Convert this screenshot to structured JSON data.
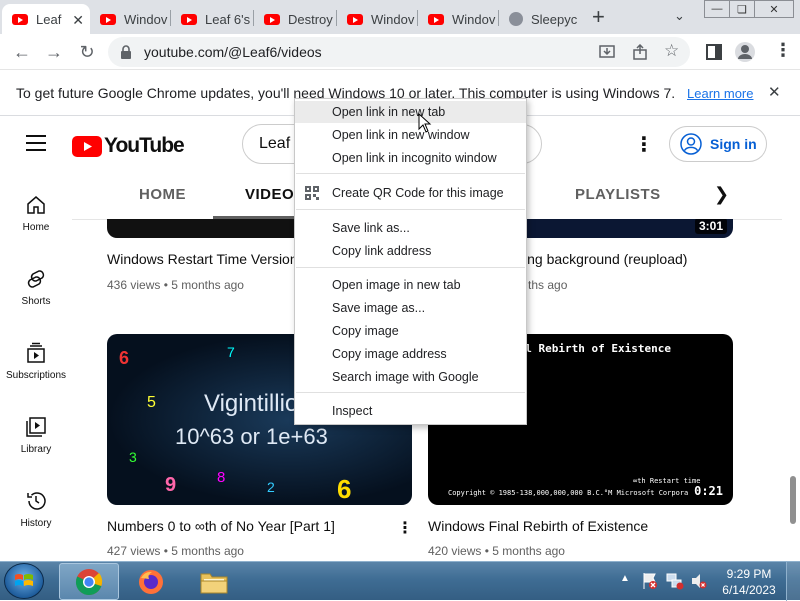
{
  "browser": {
    "tabs": [
      {
        "title": "Leaf",
        "active": true
      },
      {
        "title": "Windov"
      },
      {
        "title": "Leaf 6's"
      },
      {
        "title": "Destroy"
      },
      {
        "title": "Windov"
      },
      {
        "title": "Windov"
      },
      {
        "title": "Sleepyc"
      }
    ],
    "new_tab": "+",
    "url": "youtube.com/@Leaf6/videos"
  },
  "infobar": {
    "message": "To get future Google Chrome updates, you'll need Windows 10 or later. This computer is using Windows 7.",
    "learn_more": "Learn more",
    "close": "✕"
  },
  "youtube": {
    "logo_text": "YouTube",
    "search_value": "Leaf",
    "sign_in": "Sign in",
    "sidebar": [
      {
        "label": "Home",
        "icon": "home-icon"
      },
      {
        "label": "Shorts",
        "icon": "shorts-icon"
      },
      {
        "label": "Subscriptions",
        "icon": "subscriptions-icon"
      },
      {
        "label": "Library",
        "icon": "library-icon"
      },
      {
        "label": "History",
        "icon": "history-icon"
      }
    ],
    "channel_tabs": [
      "HOME",
      "VIDEOS",
      "PLAYLISTS"
    ],
    "videos": [
      {
        "title": "Windows Restart Time Version",
        "views": "436 views",
        "age": "5 months ago",
        "duration": ""
      },
      {
        "title": "…ing background (reupload)",
        "views": "",
        "age": "…ths ago",
        "duration": "3:01"
      },
      {
        "title": "Numbers 0 to ∞th of No Year [Part 1]",
        "views": "427 views",
        "age": "5 months ago",
        "duration": "",
        "thumb_text1": "Vigintillio",
        "thumb_text2": "10^63 or 1e+63"
      },
      {
        "title": "Windows Final Rebirth of Existence",
        "views": "420 views",
        "age": "5 months ago",
        "duration": "0:21",
        "thumb_text1": "nal Rebirth of Existence",
        "thumb_text2": "∞th Restart time",
        "thumb_text3": "Copyright © 1985-138,000,000,000 B.C.°M Microsoft Corpora"
      }
    ],
    "meta_sep": "•"
  },
  "context_menu": {
    "items": [
      {
        "label": "Open link in new tab",
        "hover": true
      },
      {
        "label": "Open link in new window"
      },
      {
        "label": "Open link in incognito window"
      },
      {
        "label": "Create QR Code for this image"
      },
      {
        "label": "Save link as..."
      },
      {
        "label": "Copy link address"
      },
      {
        "label": "Open image in new tab"
      },
      {
        "label": "Save image as..."
      },
      {
        "label": "Copy image"
      },
      {
        "label": "Copy image address"
      },
      {
        "label": "Search image with Google"
      },
      {
        "label": "Inspect"
      }
    ]
  },
  "taskbar": {
    "time": "9:29 PM",
    "date": "6/14/2023"
  },
  "colors": {
    "youtube_red": "#ff0000",
    "link_blue": "#1a73e8",
    "sign_in_blue": "#065fd4",
    "taskbar": "#3f6d94"
  }
}
